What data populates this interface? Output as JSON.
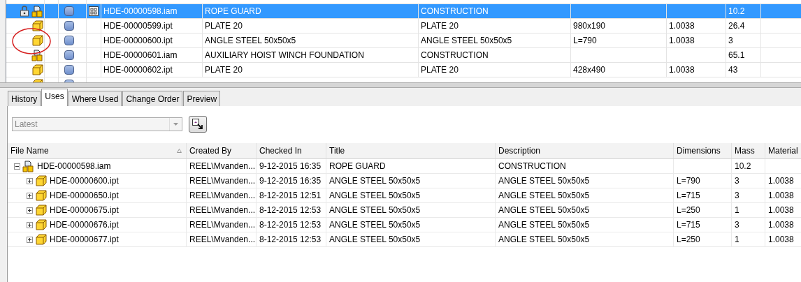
{
  "top_grid": {
    "rows": [
      {
        "locked": true,
        "kind": "assembly",
        "preview_icon": true,
        "selected": true,
        "annotated": false,
        "cells": [
          "HDE-00000598.iam",
          "ROPE GUARD",
          "CONSTRUCTION",
          "",
          "",
          "10.2"
        ]
      },
      {
        "locked": false,
        "kind": "part",
        "preview_icon": false,
        "selected": false,
        "annotated": false,
        "cells": [
          "HDE-00000599.ipt",
          "PLATE 20",
          "PLATE 20",
          "980x190",
          "1.0038",
          "26.4"
        ]
      },
      {
        "locked": false,
        "kind": "part",
        "preview_icon": false,
        "selected": false,
        "annotated": true,
        "cells": [
          "HDE-00000600.ipt",
          "ANGLE STEEL 50x50x5",
          "ANGLE STEEL 50x50x5",
          "L=790",
          "1.0038",
          "3"
        ]
      },
      {
        "locked": false,
        "kind": "assembly",
        "preview_icon": false,
        "selected": false,
        "annotated": false,
        "cells": [
          "HDE-00000601.iam",
          "AUXILIARY HOIST WINCH FOUNDATION",
          "CONSTRUCTION",
          "",
          "",
          "65.1"
        ]
      },
      {
        "locked": false,
        "kind": "part",
        "preview_icon": false,
        "selected": false,
        "annotated": false,
        "cells": [
          "HDE-00000602.ipt",
          "PLATE 20",
          "PLATE 20",
          "428x490",
          "1.0038",
          "43"
        ]
      }
    ]
  },
  "tabs": [
    {
      "label": "History",
      "selected": false
    },
    {
      "label": "Uses",
      "selected": true
    },
    {
      "label": "Where Used",
      "selected": false
    },
    {
      "label": "Change Order",
      "selected": false
    },
    {
      "label": "Preview",
      "selected": false
    }
  ],
  "version_dropdown": {
    "value": "Latest",
    "disabled": true
  },
  "uses_table": {
    "columns": [
      {
        "label": "File Name",
        "sorted": true
      },
      {
        "label": "Created By",
        "sorted": false
      },
      {
        "label": "Checked In",
        "sorted": false
      },
      {
        "label": "Title",
        "sorted": false
      },
      {
        "label": "Description",
        "sorted": false
      },
      {
        "label": "Dimensions",
        "sorted": false
      },
      {
        "label": "Mass",
        "sorted": false
      },
      {
        "label": "Material",
        "sorted": false
      }
    ],
    "rows": [
      {
        "kind": "assembly",
        "expanded": true,
        "cells": [
          "HDE-00000598.iam",
          "REEL\\Mvanden...",
          "9-12-2015 16:35",
          "ROPE GUARD",
          "CONSTRUCTION",
          "",
          "10.2",
          ""
        ],
        "children": [
          {
            "kind": "part",
            "expanded": false,
            "cells": [
              "HDE-00000600.ipt",
              "REEL\\Mvanden...",
              "9-12-2015 16:35",
              "ANGLE STEEL 50x50x5",
              "ANGLE STEEL 50x50x5",
              "L=790",
              "3",
              "1.0038"
            ]
          },
          {
            "kind": "part",
            "expanded": false,
            "cells": [
              "HDE-00000650.ipt",
              "REEL\\Mvanden...",
              "8-12-2015 12:51",
              "ANGLE STEEL 50x50x5",
              "ANGLE STEEL 50x50x5",
              "L=715",
              "3",
              "1.0038"
            ]
          },
          {
            "kind": "part",
            "expanded": false,
            "cells": [
              "HDE-00000675.ipt",
              "REEL\\Mvanden...",
              "8-12-2015 12:53",
              "ANGLE STEEL 50x50x5",
              "ANGLE STEEL 50x50x5",
              "L=250",
              "1",
              "1.0038"
            ]
          },
          {
            "kind": "part",
            "expanded": false,
            "cells": [
              "HDE-00000676.ipt",
              "REEL\\Mvanden...",
              "8-12-2015 12:53",
              "ANGLE STEEL 50x50x5",
              "ANGLE STEEL 50x50x5",
              "L=715",
              "3",
              "1.0038"
            ]
          },
          {
            "kind": "part",
            "expanded": false,
            "cells": [
              "HDE-00000677.ipt",
              "REEL\\Mvanden...",
              "8-12-2015 12:53",
              "ANGLE STEEL 50x50x5",
              "ANGLE STEEL 50x50x5",
              "L=250",
              "1",
              "1.0038"
            ]
          }
        ]
      }
    ]
  }
}
